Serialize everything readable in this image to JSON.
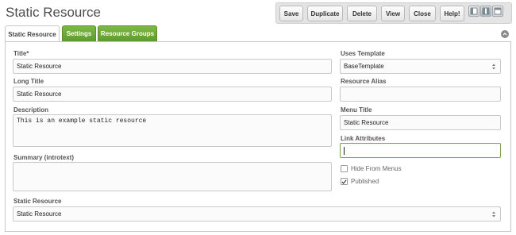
{
  "page": {
    "title": "Static Resource"
  },
  "toolbar": {
    "save": "Save",
    "duplicate": "Duplicate",
    "delete": "Delete",
    "view": "View",
    "close": "Close",
    "help": "Help!"
  },
  "tabs": [
    {
      "label": "Static Resource",
      "active": true
    },
    {
      "label": "Settings",
      "active": false
    },
    {
      "label": "Resource Groups",
      "active": false
    }
  ],
  "form": {
    "title": {
      "label": "Title*",
      "value": "Static Resource"
    },
    "long_title": {
      "label": "Long Title",
      "value": "Static Resource"
    },
    "description": {
      "label": "Description",
      "value": "This is an example static resource"
    },
    "summary": {
      "label": "Summary (introtext)",
      "value": ""
    },
    "static_resource": {
      "label": "Static Resource",
      "value": "Static Resource"
    },
    "uses_template": {
      "label": "Uses Template",
      "value": "BaseTemplate"
    },
    "resource_alias": {
      "label": "Resource Alias",
      "value": ""
    },
    "menu_title": {
      "label": "Menu Title",
      "value": "Static Resource"
    },
    "link_attributes": {
      "label": "Link Attributes",
      "value": ""
    },
    "hide_from_menus": {
      "label": "Hide From Menus",
      "checked": false
    },
    "published": {
      "label": "Published",
      "checked": true
    }
  },
  "colors": {
    "accent_green": "#6aa535",
    "focus_border": "#7ba34a"
  }
}
